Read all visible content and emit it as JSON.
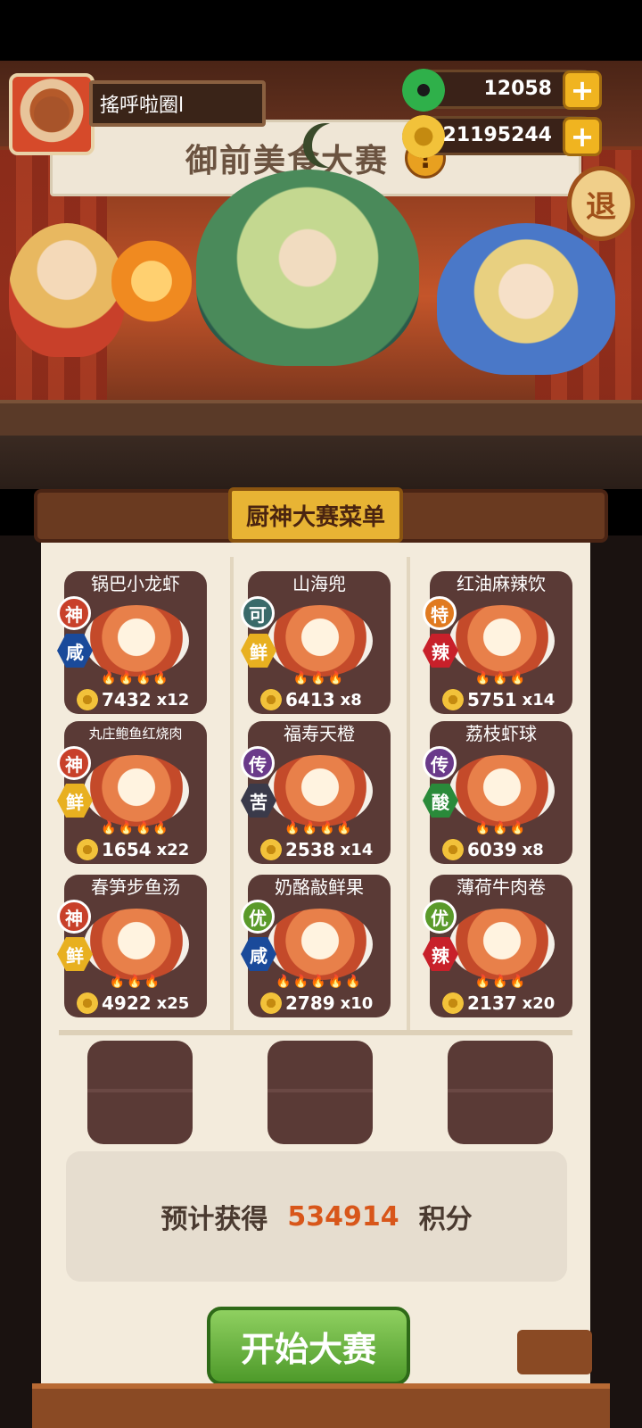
{
  "player": {
    "name": "搖呼啦圈l"
  },
  "resources": [
    {
      "icon": "jade-icon",
      "value": "12058"
    },
    {
      "icon": "gold-coin-icon",
      "value": "21195244"
    }
  ],
  "stage": {
    "banner": "御前美食大赛",
    "exit_label": "退"
  },
  "menu": {
    "title": "厨神大赛菜单",
    "dishes": [
      {
        "name": "锅巴小龙虾",
        "tier": "神",
        "flavor": "咸",
        "cost": "7432",
        "mult": "x12",
        "flames": "🔥🔥🔥🔥"
      },
      {
        "name": "山海兜",
        "tier": "可",
        "flavor": "鲜",
        "cost": "6413",
        "mult": "x8",
        "flames": "🔥🔥🔥"
      },
      {
        "name": "红油麻辣饮",
        "tier": "特",
        "flavor": "辣",
        "cost": "5751",
        "mult": "x14",
        "flames": "🔥🔥🔥"
      },
      {
        "name": "丸庄鲍鱼红烧肉",
        "tier": "神",
        "flavor": "鲜",
        "cost": "1654",
        "mult": "x22",
        "flames": "🔥🔥🔥🔥"
      },
      {
        "name": "福寿天橙",
        "tier": "传",
        "flavor": "苦",
        "cost": "2538",
        "mult": "x14",
        "flames": "🔥🔥🔥🔥"
      },
      {
        "name": "荔枝虾球",
        "tier": "传",
        "flavor": "酸",
        "cost": "6039",
        "mult": "x8",
        "flames": "🔥🔥🔥"
      },
      {
        "name": "春笋步鱼汤",
        "tier": "神",
        "flavor": "鲜",
        "cost": "4922",
        "mult": "x25",
        "flames": "🔥🔥🔥"
      },
      {
        "name": "奶酪敲鲜果",
        "tier": "优",
        "flavor": "咸",
        "cost": "2789",
        "mult": "x10",
        "flames": "🔥🔥🔥🔥🔥"
      },
      {
        "name": "薄荷牛肉卷",
        "tier": "优",
        "flavor": "辣",
        "cost": "2137",
        "mult": "x20",
        "flames": "🔥🔥🔥"
      }
    ]
  },
  "score": {
    "label": "预计获得",
    "value": "534914",
    "unit": "积分"
  },
  "start_button": "开始大赛",
  "colors": {
    "tier_神": "#c8402a",
    "tier_可": "#3a6a6a",
    "tier_特": "#e07a20",
    "tier_传": "#6a3a8a",
    "tier_优": "#5a9a2a",
    "flavor_咸": "#1a4a9a",
    "flavor_鲜": "#e8b020",
    "flavor_辣": "#c8202a",
    "flavor_苦": "#3a3a4a",
    "flavor_酸": "#2a8a3a"
  }
}
